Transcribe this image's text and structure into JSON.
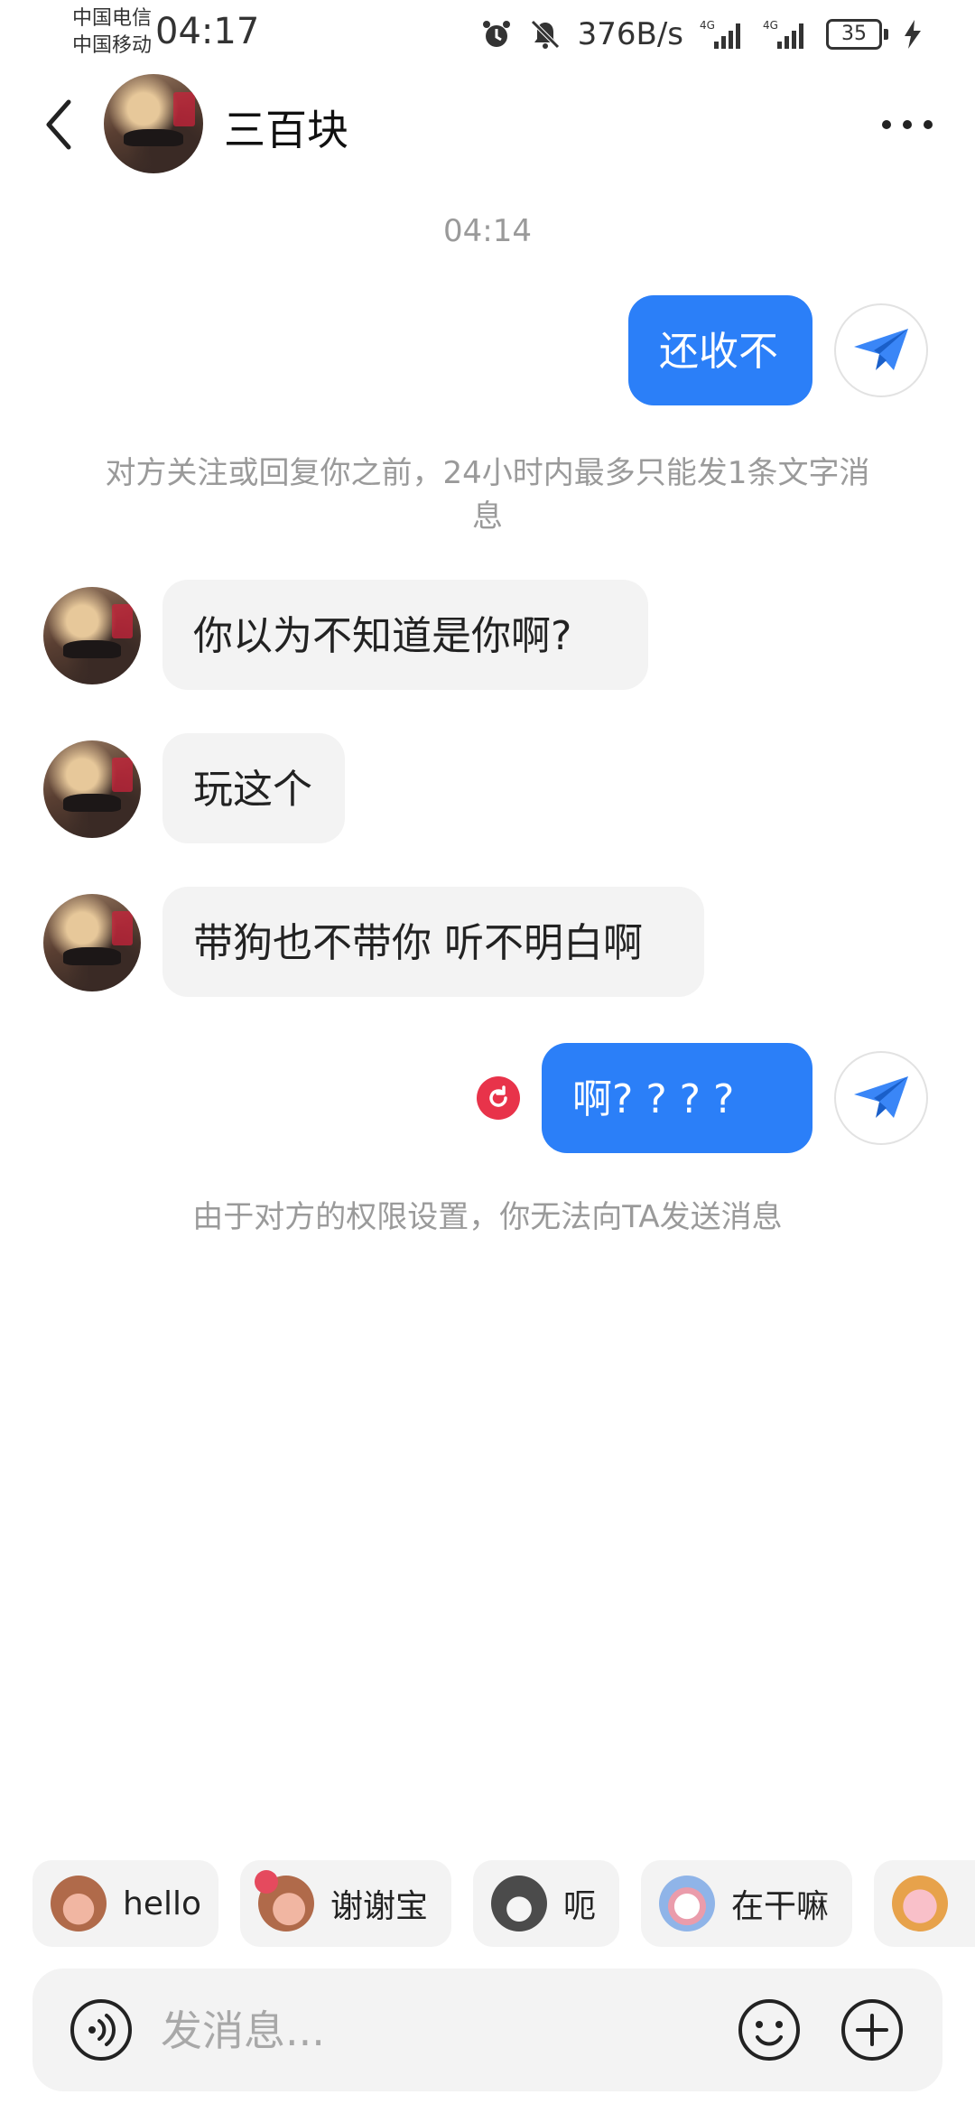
{
  "status_bar": {
    "carrier_1": "中国电信",
    "carrier_2": "中国移动",
    "time": "04:17",
    "speed": "376B/s",
    "network_1": "4G",
    "network_2": "4G",
    "battery": "35",
    "icons": [
      "alarm-icon",
      "mute-icon",
      "signal-icon",
      "signal-icon",
      "battery-icon",
      "charging-icon"
    ]
  },
  "header": {
    "contact_name": "三百块"
  },
  "chat": {
    "timestamp": "04:14",
    "message_1": "还收不",
    "limit_notice": "对方关注或回复你之前，24小时内最多只能发1条文字消息",
    "reply_1": "你以为不知道是你啊?",
    "reply_2": "玩这个",
    "reply_3": "带狗也不带你 听不明白啊",
    "message_2": "啊? ? ? ?",
    "blocked_notice": "由于对方的权限设置，你无法向TA发送消息"
  },
  "quick_replies": [
    {
      "label": "hello",
      "emoji": "monkey"
    },
    {
      "label": "谢谢宝",
      "emoji": "monkey-rose"
    },
    {
      "label": "呃",
      "emoji": "cat"
    },
    {
      "label": "在干嘛",
      "emoji": "bunny"
    },
    {
      "label": "",
      "emoji": "pig"
    }
  ],
  "input": {
    "placeholder": "发消息..."
  },
  "colors": {
    "accent": "#2b7ff8",
    "bubble_grey": "#f3f3f3",
    "error": "#e8334a"
  }
}
